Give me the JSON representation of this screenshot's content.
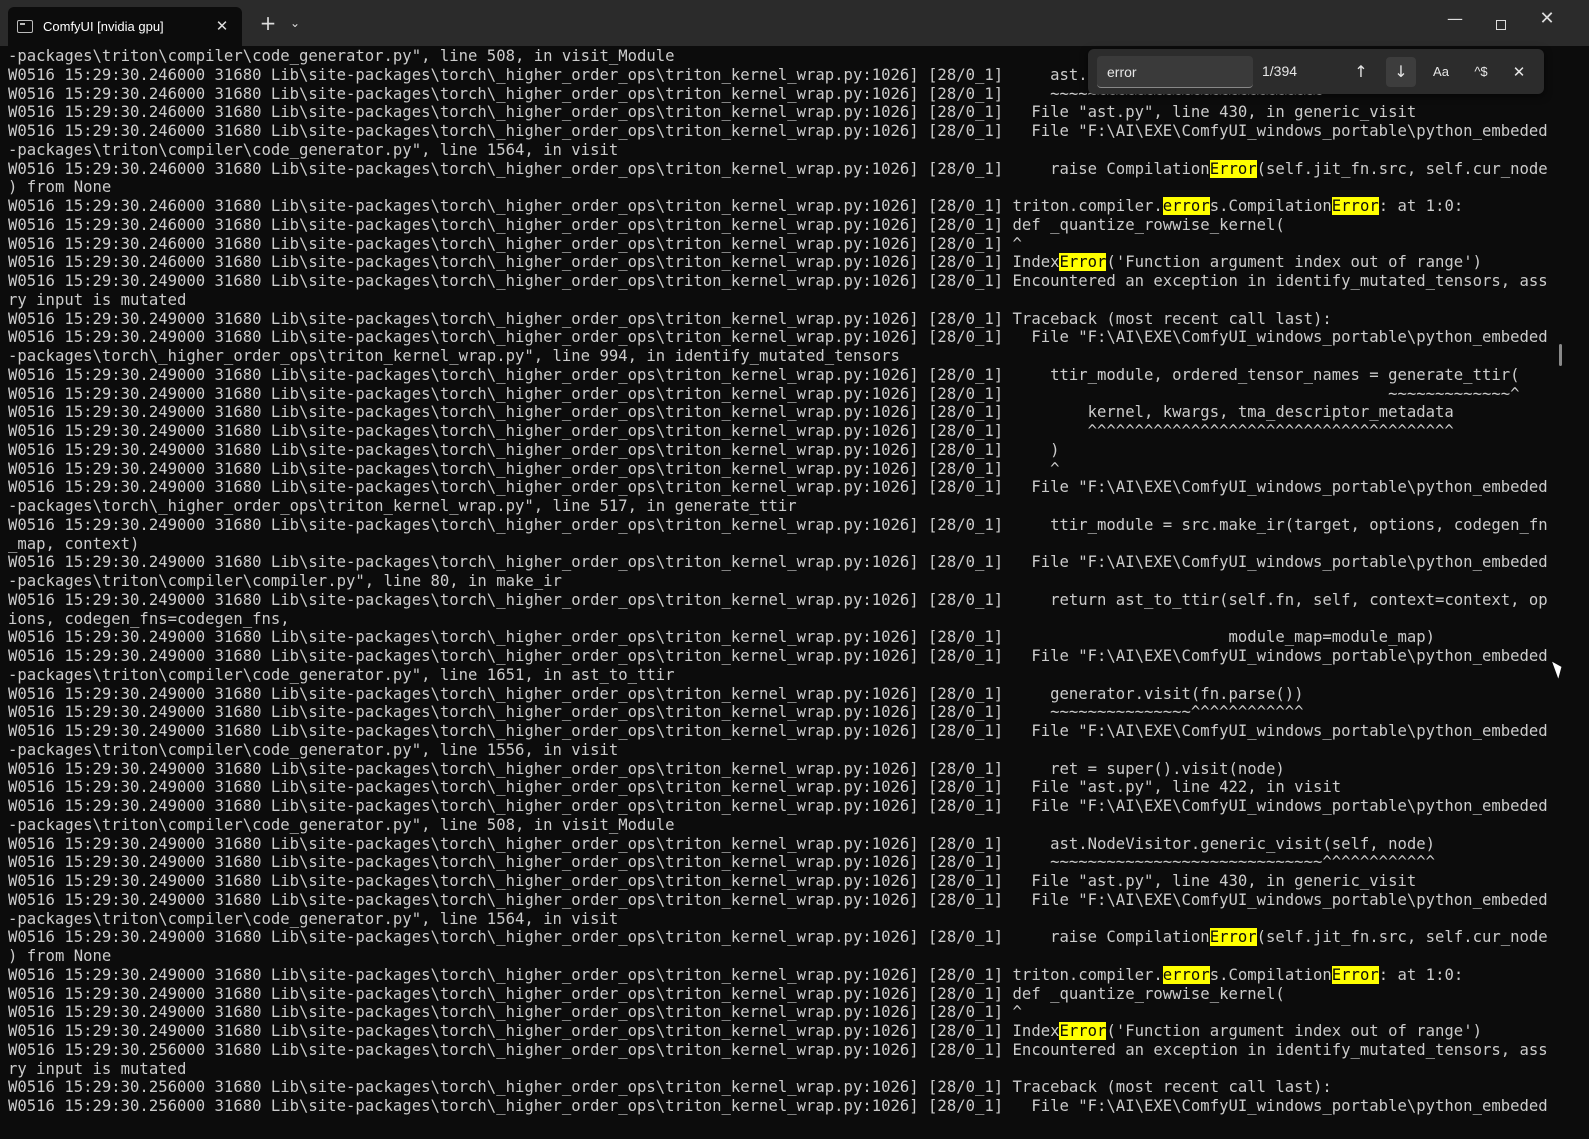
{
  "window": {
    "tab_title": "ComfyUI [nvidia gpu]",
    "tab_close": "✕",
    "new_tab": "+",
    "tab_menu": "⌄",
    "minimize": "—",
    "close": "✕"
  },
  "find": {
    "query": "error",
    "count": "1/394",
    "up": "↑",
    "down": "↓",
    "case_label": "Aa",
    "regex_label": "^$",
    "close": "✕"
  },
  "highlight_color": "#ffff00",
  "terminal": {
    "lines": [
      "-packages\\triton\\compiler\\code_generator.py\", line 508, in visit_Module",
      "W0516 15:29:30.246000 31680 Lib\\site-packages\\torch\\_higher_order_ops\\triton_kernel_wrap.py:1026] [28/0_1]     ast.NodeVisitor.generic_visit(self, node)",
      "W0516 15:29:30.246000 31680 Lib\\site-packages\\torch\\_higher_order_ops\\triton_kernel_wrap.py:1026] [28/0_1]     ~~~~~~~~~~~~~~~~~~~~~~~~~~~~~^^^^^^^^^^^^",
      "W0516 15:29:30.246000 31680 Lib\\site-packages\\torch\\_higher_order_ops\\triton_kernel_wrap.py:1026] [28/0_1]   File \"ast.py\", line 430, in generic_visit",
      "W0516 15:29:30.246000 31680 Lib\\site-packages\\torch\\_higher_order_ops\\triton_kernel_wrap.py:1026] [28/0_1]   File \"F:\\AI\\EXE\\ComfyUI_windows_portable\\python_embeded\\Lib\\site",
      "-packages\\triton\\compiler\\code_generator.py\", line 1564, in visit",
      "W0516 15:29:30.246000 31680 Lib\\site-packages\\torch\\_higher_order_ops\\triton_kernel_wrap.py:1026] [28/0_1]     raise CompilationError(self.jit_fn.src, self.cur_node, repr(e)",
      ") from None",
      "W0516 15:29:30.246000 31680 Lib\\site-packages\\torch\\_higher_order_ops\\triton_kernel_wrap.py:1026] [28/0_1] triton.compiler.errors.CompilationError: at 1:0:",
      "W0516 15:29:30.246000 31680 Lib\\site-packages\\torch\\_higher_order_ops\\triton_kernel_wrap.py:1026] [28/0_1] def _quantize_rowwise_kernel(",
      "W0516 15:29:30.246000 31680 Lib\\site-packages\\torch\\_higher_order_ops\\triton_kernel_wrap.py:1026] [28/0_1] ^",
      "W0516 15:29:30.246000 31680 Lib\\site-packages\\torch\\_higher_order_ops\\triton_kernel_wrap.py:1026] [28/0_1] IndexError('Function argument index out of range')",
      "W0516 15:29:30.249000 31680 Lib\\site-packages\\torch\\_higher_order_ops\\triton_kernel_wrap.py:1026] [28/0_1] Encountered an exception in identify_mutated_tensors, assuming eve",
      "ry input is mutated",
      "W0516 15:29:30.249000 31680 Lib\\site-packages\\torch\\_higher_order_ops\\triton_kernel_wrap.py:1026] [28/0_1] Traceback (most recent call last):",
      "W0516 15:29:30.249000 31680 Lib\\site-packages\\torch\\_higher_order_ops\\triton_kernel_wrap.py:1026] [28/0_1]   File \"F:\\AI\\EXE\\ComfyUI_windows_portable\\python_embeded\\Lib\\site",
      "-packages\\torch\\_higher_order_ops\\triton_kernel_wrap.py\", line 994, in identify_mutated_tensors",
      "W0516 15:29:30.249000 31680 Lib\\site-packages\\torch\\_higher_order_ops\\triton_kernel_wrap.py:1026] [28/0_1]     ttir_module, ordered_tensor_names = generate_ttir(",
      "W0516 15:29:30.249000 31680 Lib\\site-packages\\torch\\_higher_order_ops\\triton_kernel_wrap.py:1026] [28/0_1]                                         ~~~~~~~~~~~~~^",
      "W0516 15:29:30.249000 31680 Lib\\site-packages\\torch\\_higher_order_ops\\triton_kernel_wrap.py:1026] [28/0_1]         kernel, kwargs, tma_descriptor_metadata",
      "W0516 15:29:30.249000 31680 Lib\\site-packages\\torch\\_higher_order_ops\\triton_kernel_wrap.py:1026] [28/0_1]         ^^^^^^^^^^^^^^^^^^^^^^^^^^^^^^^^^^^^^^^",
      "W0516 15:29:30.249000 31680 Lib\\site-packages\\torch\\_higher_order_ops\\triton_kernel_wrap.py:1026] [28/0_1]     )",
      "W0516 15:29:30.249000 31680 Lib\\site-packages\\torch\\_higher_order_ops\\triton_kernel_wrap.py:1026] [28/0_1]     ^",
      "W0516 15:29:30.249000 31680 Lib\\site-packages\\torch\\_higher_order_ops\\triton_kernel_wrap.py:1026] [28/0_1]   File \"F:\\AI\\EXE\\ComfyUI_windows_portable\\python_embeded\\Lib\\site",
      "-packages\\torch\\_higher_order_ops\\triton_kernel_wrap.py\", line 517, in generate_ttir",
      "W0516 15:29:30.249000 31680 Lib\\site-packages\\torch\\_higher_order_ops\\triton_kernel_wrap.py:1026] [28/0_1]     ttir_module = src.make_ir(target, options, codegen_fns, module",
      "_map, context)",
      "W0516 15:29:30.249000 31680 Lib\\site-packages\\torch\\_higher_order_ops\\triton_kernel_wrap.py:1026] [28/0_1]   File \"F:\\AI\\EXE\\ComfyUI_windows_portable\\python_embeded\\Lib\\site",
      "-packages\\triton\\compiler\\compiler.py\", line 80, in make_ir",
      "W0516 15:29:30.249000 31680 Lib\\site-packages\\torch\\_higher_order_ops\\triton_kernel_wrap.py:1026] [28/0_1]     return ast_to_ttir(self.fn, self, context=context, options=opt",
      "ions, codegen_fns=codegen_fns,",
      "W0516 15:29:30.249000 31680 Lib\\site-packages\\torch\\_higher_order_ops\\triton_kernel_wrap.py:1026] [28/0_1]                        module_map=module_map)",
      "W0516 15:29:30.249000 31680 Lib\\site-packages\\torch\\_higher_order_ops\\triton_kernel_wrap.py:1026] [28/0_1]   File \"F:\\AI\\EXE\\ComfyUI_windows_portable\\python_embeded\\Lib\\site",
      "-packages\\triton\\compiler\\code_generator.py\", line 1651, in ast_to_ttir",
      "W0516 15:29:30.249000 31680 Lib\\site-packages\\torch\\_higher_order_ops\\triton_kernel_wrap.py:1026] [28/0_1]     generator.visit(fn.parse())",
      "W0516 15:29:30.249000 31680 Lib\\site-packages\\torch\\_higher_order_ops\\triton_kernel_wrap.py:1026] [28/0_1]     ~~~~~~~~~~~~~~~^^^^^^^^^^^^",
      "W0516 15:29:30.249000 31680 Lib\\site-packages\\torch\\_higher_order_ops\\triton_kernel_wrap.py:1026] [28/0_1]   File \"F:\\AI\\EXE\\ComfyUI_windows_portable\\python_embeded\\Lib\\site",
      "-packages\\triton\\compiler\\code_generator.py\", line 1556, in visit",
      "W0516 15:29:30.249000 31680 Lib\\site-packages\\torch\\_higher_order_ops\\triton_kernel_wrap.py:1026] [28/0_1]     ret = super().visit(node)",
      "W0516 15:29:30.249000 31680 Lib\\site-packages\\torch\\_higher_order_ops\\triton_kernel_wrap.py:1026] [28/0_1]   File \"ast.py\", line 422, in visit",
      "W0516 15:29:30.249000 31680 Lib\\site-packages\\torch\\_higher_order_ops\\triton_kernel_wrap.py:1026] [28/0_1]   File \"F:\\AI\\EXE\\ComfyUI_windows_portable\\python_embeded\\Lib\\site",
      "-packages\\triton\\compiler\\code_generator.py\", line 508, in visit_Module",
      "W0516 15:29:30.249000 31680 Lib\\site-packages\\torch\\_higher_order_ops\\triton_kernel_wrap.py:1026] [28/0_1]     ast.NodeVisitor.generic_visit(self, node)",
      "W0516 15:29:30.249000 31680 Lib\\site-packages\\torch\\_higher_order_ops\\triton_kernel_wrap.py:1026] [28/0_1]     ~~~~~~~~~~~~~~~~~~~~~~~~~~~~~^^^^^^^^^^^^",
      "W0516 15:29:30.249000 31680 Lib\\site-packages\\torch\\_higher_order_ops\\triton_kernel_wrap.py:1026] [28/0_1]   File \"ast.py\", line 430, in generic_visit",
      "W0516 15:29:30.249000 31680 Lib\\site-packages\\torch\\_higher_order_ops\\triton_kernel_wrap.py:1026] [28/0_1]   File \"F:\\AI\\EXE\\ComfyUI_windows_portable\\python_embeded\\Lib\\site",
      "-packages\\triton\\compiler\\code_generator.py\", line 1564, in visit",
      "W0516 15:29:30.249000 31680 Lib\\site-packages\\torch\\_higher_order_ops\\triton_kernel_wrap.py:1026] [28/0_1]     raise CompilationError(self.jit_fn.src, self.cur_node, repr(e)",
      ") from None",
      "W0516 15:29:30.249000 31680 Lib\\site-packages\\torch\\_higher_order_ops\\triton_kernel_wrap.py:1026] [28/0_1] triton.compiler.errors.CompilationError: at 1:0:",
      "W0516 15:29:30.249000 31680 Lib\\site-packages\\torch\\_higher_order_ops\\triton_kernel_wrap.py:1026] [28/0_1] def _quantize_rowwise_kernel(",
      "W0516 15:29:30.249000 31680 Lib\\site-packages\\torch\\_higher_order_ops\\triton_kernel_wrap.py:1026] [28/0_1] ^",
      "W0516 15:29:30.249000 31680 Lib\\site-packages\\torch\\_higher_order_ops\\triton_kernel_wrap.py:1026] [28/0_1] IndexError('Function argument index out of range')",
      "W0516 15:29:30.256000 31680 Lib\\site-packages\\torch\\_higher_order_ops\\triton_kernel_wrap.py:1026] [28/0_1] Encountered an exception in identify_mutated_tensors, assuming eve",
      "ry input is mutated",
      "W0516 15:29:30.256000 31680 Lib\\site-packages\\torch\\_higher_order_ops\\triton_kernel_wrap.py:1026] [28/0_1] Traceback (most recent call last):",
      "W0516 15:29:30.256000 31680 Lib\\site-packages\\torch\\_higher_order_ops\\triton_kernel_wrap.py:1026] [28/0_1]   File \"F:\\AI\\EXE\\ComfyUI_windows_portable\\python_embeded\\Lib\\site"
    ]
  }
}
